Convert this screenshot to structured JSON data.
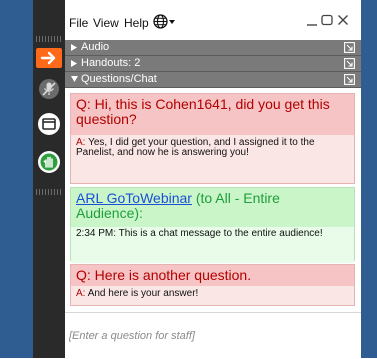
{
  "menubar": {
    "file": "File",
    "view": "View",
    "help": "Help"
  },
  "toolbar_icons": [
    "arrow-right-icon",
    "muted-mic-icon",
    "screen-icon",
    "raise-hand-icon"
  ],
  "sections": {
    "audio": "Audio",
    "handouts": "Handouts: 2",
    "questions": "Questions/Chat"
  },
  "messages": {
    "q1": {
      "q_prefix": "Q:",
      "q_text": "Hi, this is Cohen1641, did you get this question?",
      "a_prefix": "A:",
      "a_text": "Yes, I did get your question, and I assigned it to the Panelist, and now he is answering you!"
    },
    "broadcast": {
      "sender": "ARL GoToWebinar",
      "audience": "(to All - Entire Audience):",
      "time": "2:34 PM:",
      "text": "This is a chat message to the entire audience!"
    },
    "q2": {
      "q_prefix": "Q:",
      "q_text": "Here is another question.",
      "a_prefix": "A:",
      "a_text": "And here is your answer!"
    }
  },
  "input": {
    "placeholder": "[Enter a question for staff]"
  },
  "colors": {
    "frame_blue": "#2f5d91",
    "toolbar_dark": "#2a2a2a",
    "accent_orange": "#ff6a1a",
    "section_gray": "#7a7a7a",
    "question_bg": "#f6c4c4",
    "question_text": "#b30000",
    "broadcast_bg": "#c9f5c9",
    "broadcast_green": "#1f9e3a",
    "link_blue": "#1a4fd6"
  }
}
